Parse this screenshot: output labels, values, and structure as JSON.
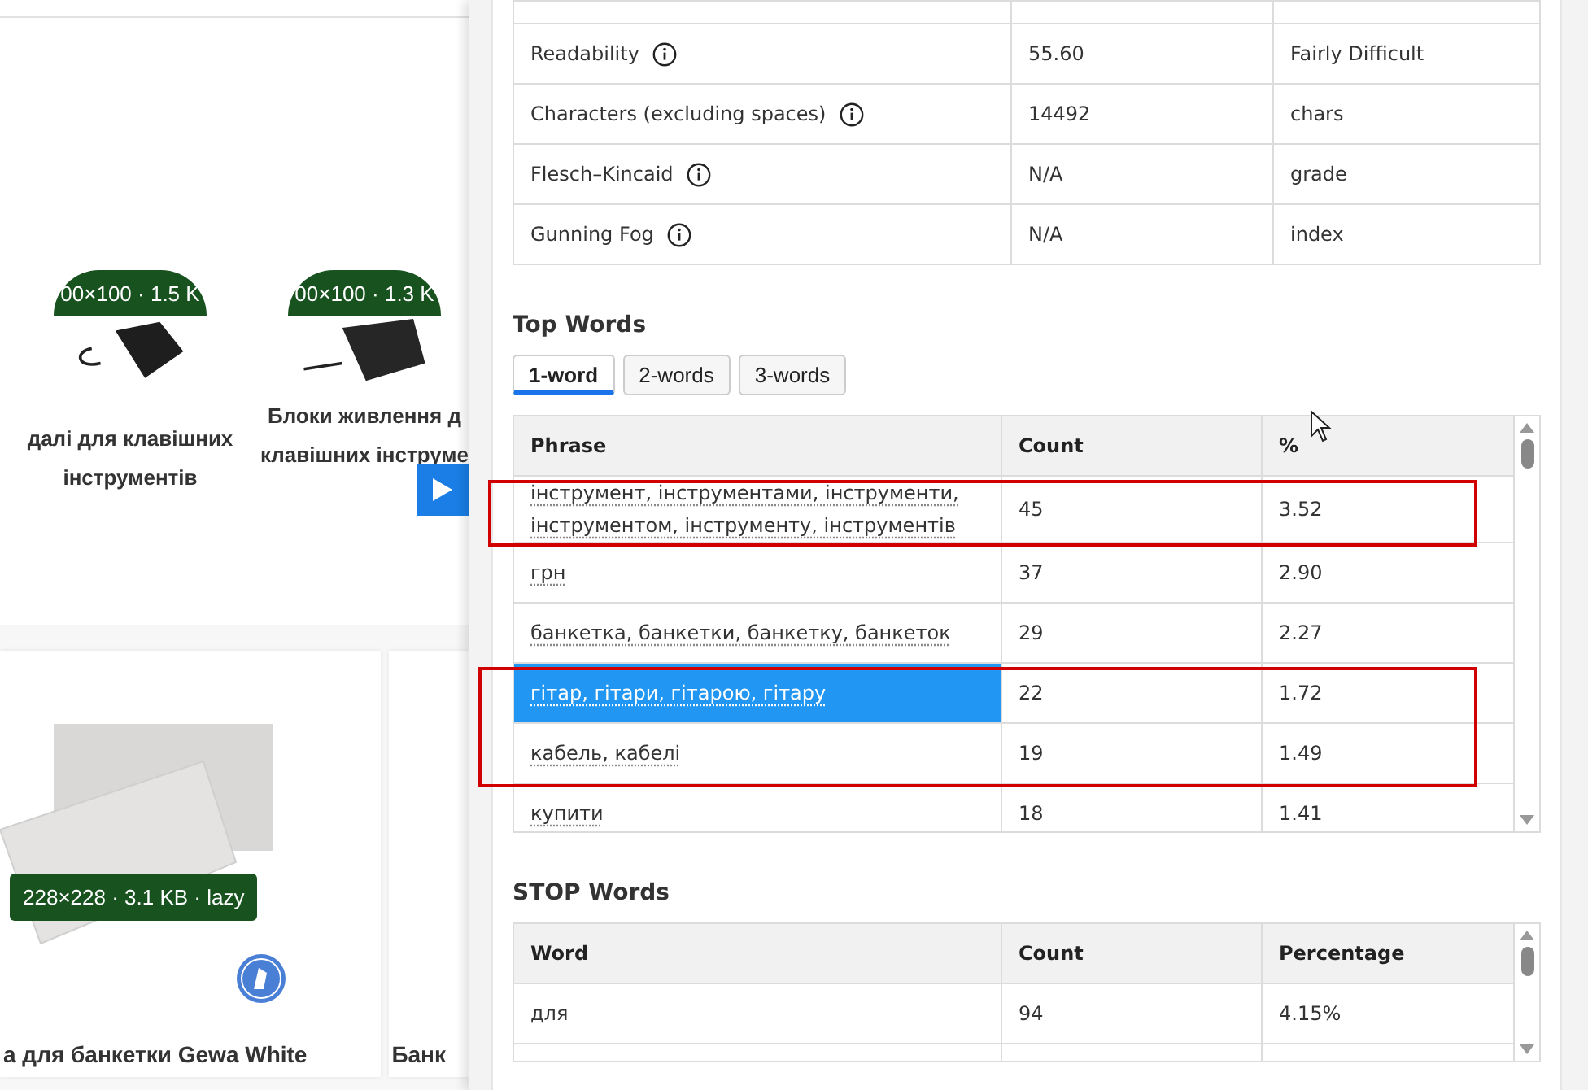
{
  "product_grid": {
    "top_items": [
      {
        "badge": "00×100 · 1.5 K",
        "title": "далі для клавішних інструментів"
      },
      {
        "badge": "00×100 · 1.3 K",
        "title": "Блоки живлення д клавішних інструме"
      }
    ],
    "bottom_items": [
      {
        "badge": "228×228 · 3.1 KB · lazy",
        "title": "а для банкетки Gewa White"
      },
      {
        "title": "Банк"
      }
    ]
  },
  "panel": {
    "metrics": [
      {
        "label": "Readability",
        "value": "55.60",
        "unit": "Fairly Difficult"
      },
      {
        "label": "Characters (excluding spaces)",
        "value": "14492",
        "unit": "chars"
      },
      {
        "label": "Flesch–Kincaid",
        "value": "N/A",
        "unit": "grade"
      },
      {
        "label": "Gunning Fog",
        "value": "N/A",
        "unit": "index"
      }
    ],
    "top_words": {
      "heading": "Top Words",
      "tabs": [
        {
          "label": "1-word",
          "selected": true
        },
        {
          "label": "2-words",
          "selected": false
        },
        {
          "label": "3-words",
          "selected": false
        }
      ],
      "columns": [
        "Phrase",
        "Count",
        "%"
      ],
      "rows": [
        {
          "phrase": "інструмент, інструментами, інструменти, інструментом, інструменту, інструментів",
          "count": "45",
          "percent": "3.52",
          "selected": false,
          "outlined": true
        },
        {
          "phrase": "грн",
          "count": "37",
          "percent": "2.90",
          "selected": false,
          "outlined": false
        },
        {
          "phrase": "банкетка, банкетки, банкетку, банкеток",
          "count": "29",
          "percent": "2.27",
          "selected": false,
          "outlined": false
        },
        {
          "phrase": "гітар, гітари, гітарою, гітару",
          "count": "22",
          "percent": "1.72",
          "selected": true,
          "outlined": true
        },
        {
          "phrase": "кабель, кабелі",
          "count": "19",
          "percent": "1.49",
          "selected": false,
          "outlined": true
        },
        {
          "phrase": "купити",
          "count": "18",
          "percent": "1.41",
          "selected": false,
          "outlined": false
        }
      ]
    },
    "stop_words": {
      "heading": "STOP Words",
      "columns": [
        "Word",
        "Count",
        "Percentage"
      ],
      "rows": [
        {
          "word": "для",
          "count": "94",
          "percent": "4.15%"
        }
      ]
    }
  }
}
